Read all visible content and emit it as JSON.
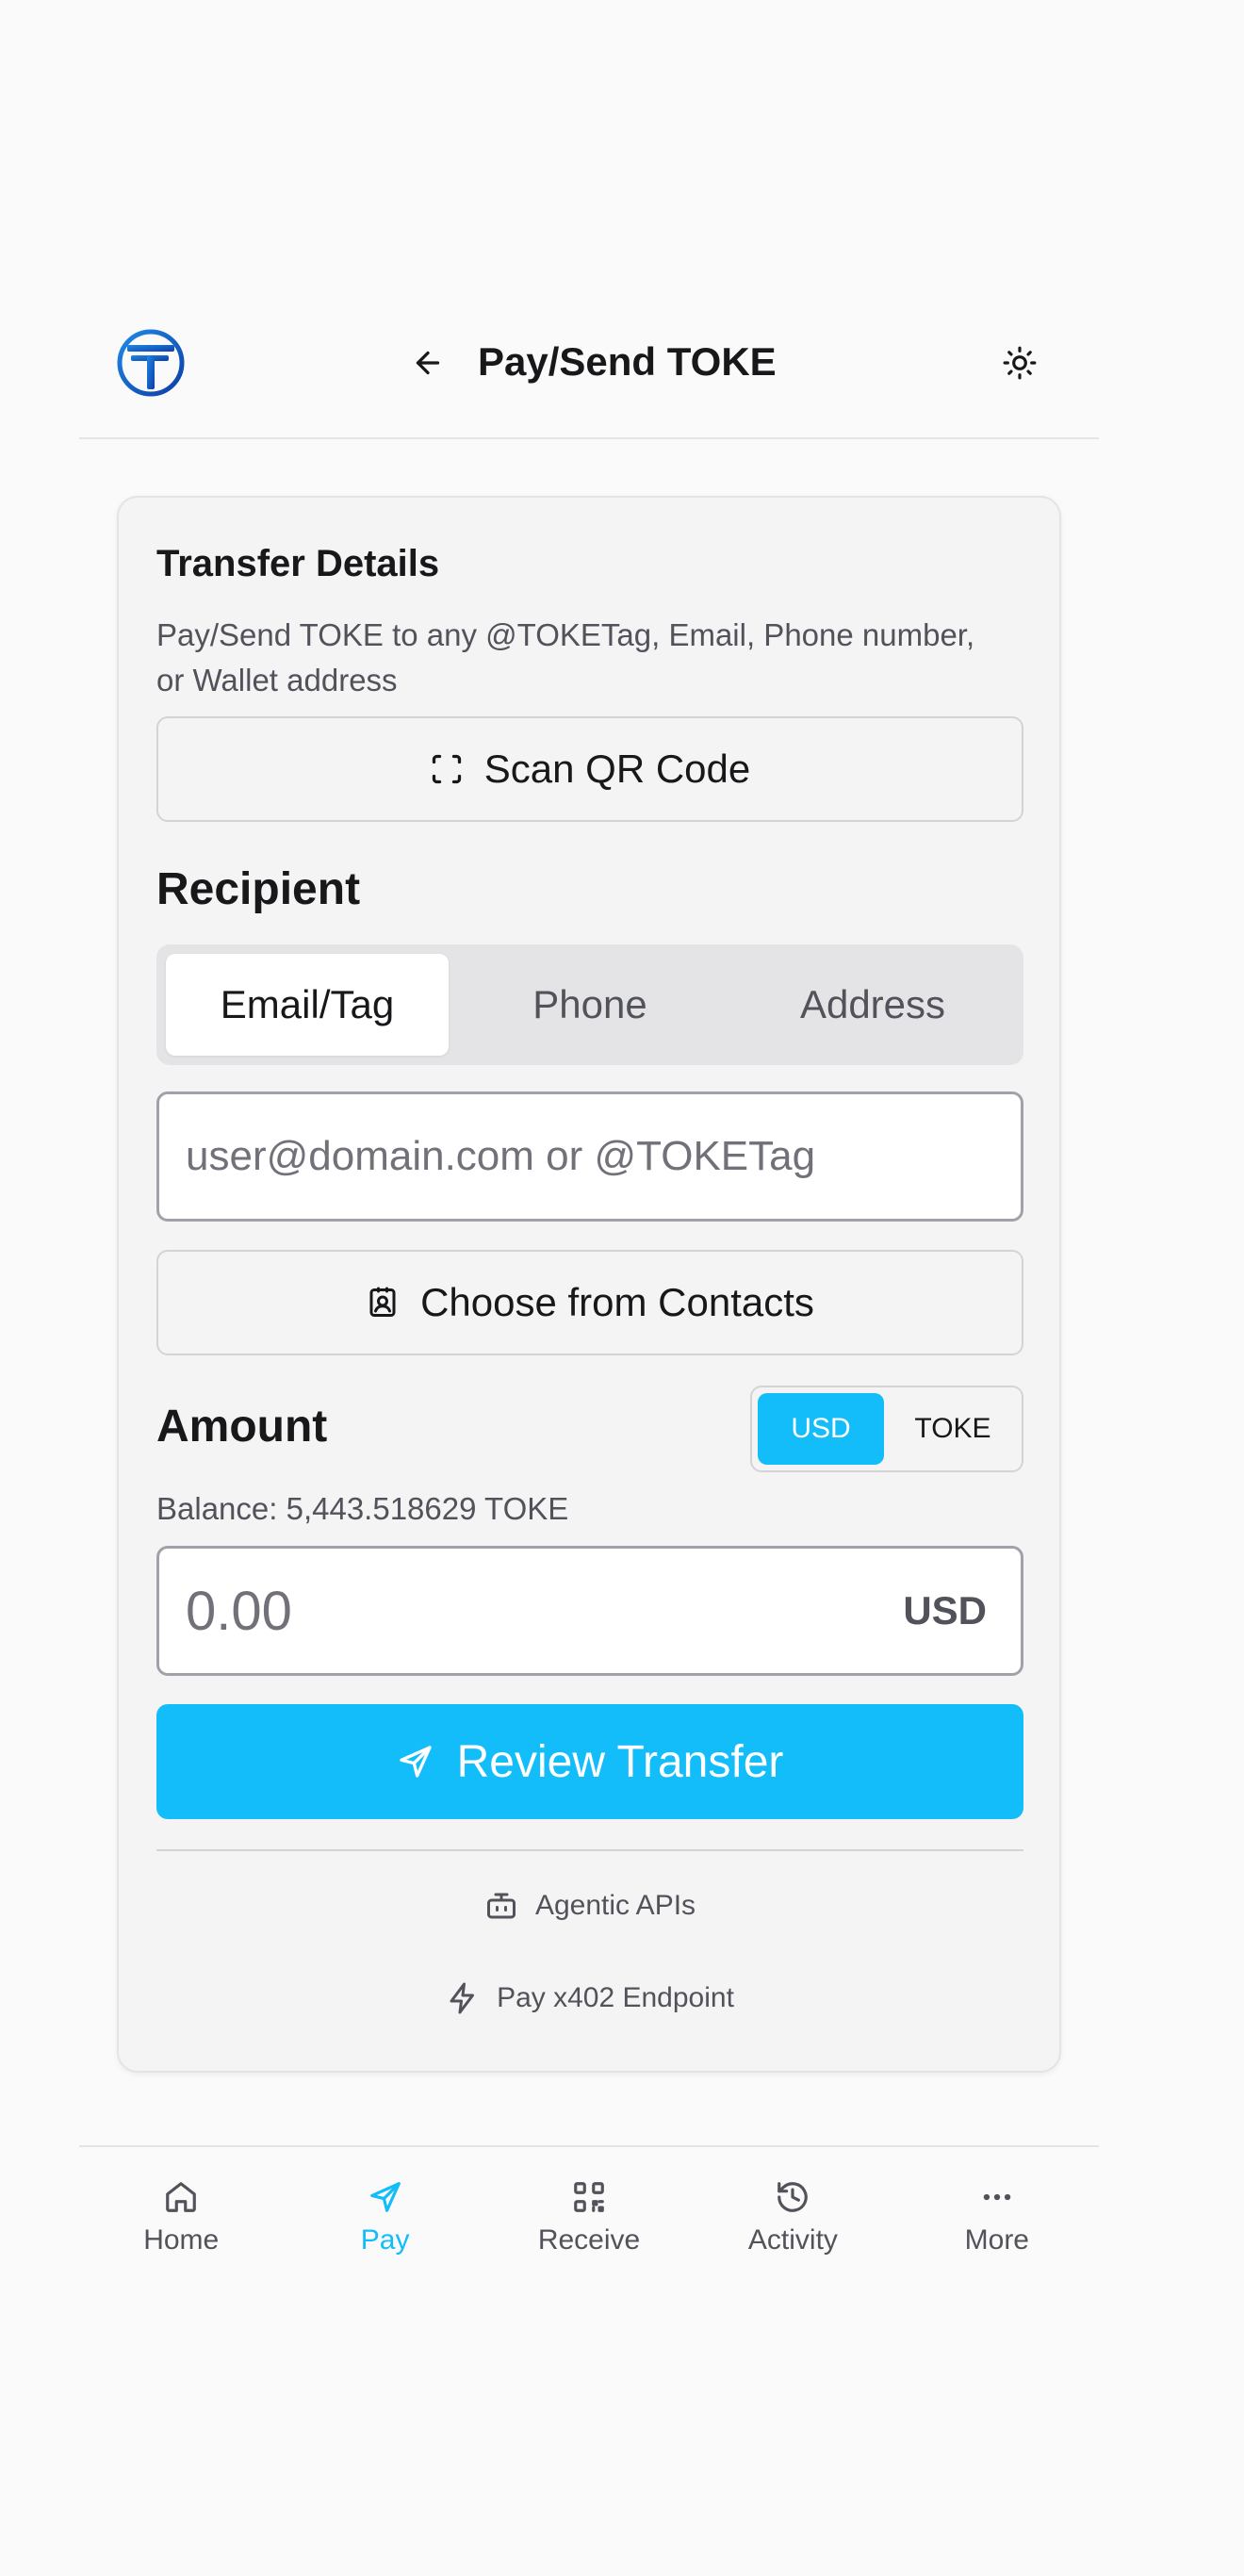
{
  "header": {
    "title": "Pay/Send TOKE",
    "logo_icon": "toke-logo",
    "back_icon": "arrow-left-icon",
    "theme_icon": "sun-icon"
  },
  "card": {
    "title": "Transfer Details",
    "description": "Pay/Send TOKE to any @TOKETag, Email, Phone number, or Wallet address",
    "scan_label": "Scan QR Code",
    "recipient_label": "Recipient",
    "tabs": [
      {
        "label": "Email/Tag",
        "active": true
      },
      {
        "label": "Phone",
        "active": false
      },
      {
        "label": "Address",
        "active": false
      }
    ],
    "recipient_placeholder": "user@domain.com or @TOKETag",
    "recipient_value": "",
    "contacts_label": "Choose from Contacts",
    "amount_label": "Amount",
    "currency_options": [
      "USD",
      "TOKE"
    ],
    "selected_currency": "USD",
    "balance": "Balance: 5,443.518629 TOKE",
    "amount_placeholder": "0.00",
    "amount_unit": "USD",
    "review_label": "Review Transfer",
    "links": {
      "agentic": "Agentic APIs",
      "x402": "Pay x402 Endpoint"
    }
  },
  "nav": [
    {
      "label": "Home",
      "icon": "home-icon",
      "active": false
    },
    {
      "label": "Pay",
      "icon": "send-icon",
      "active": true
    },
    {
      "label": "Receive",
      "icon": "qr-code-icon",
      "active": false
    },
    {
      "label": "Activity",
      "icon": "history-icon",
      "active": false
    },
    {
      "label": "More",
      "icon": "more-icon",
      "active": false
    }
  ],
  "colors": {
    "accent": "#12bdfa",
    "logo_blue": "#1d5fc7",
    "background": "#fafafa",
    "card": "#f4f4f5"
  }
}
